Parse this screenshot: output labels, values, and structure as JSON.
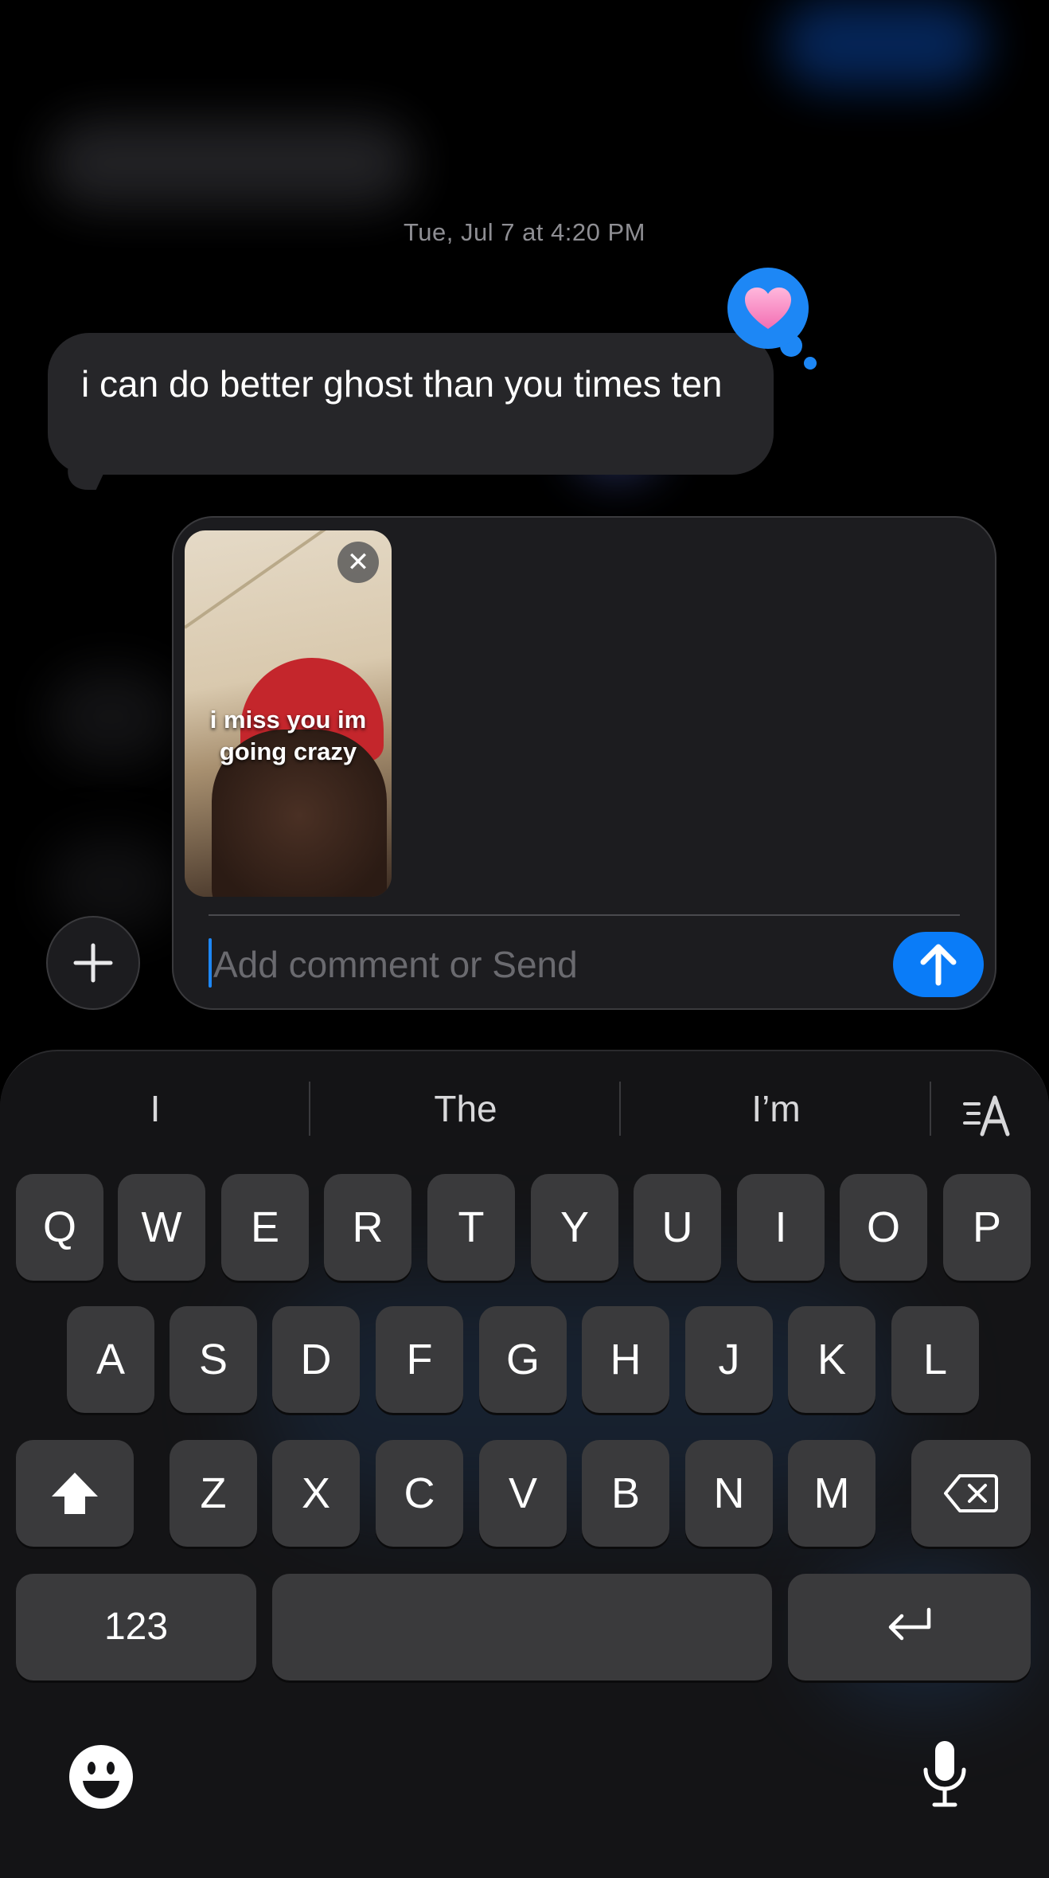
{
  "conversation": {
    "timestamp": "Tue, Jul 7 at 4:20 PM",
    "message_text": "i can do better ghost than you times ten",
    "tapback": "heart"
  },
  "compose": {
    "attachment_caption_line1": "i miss you im",
    "attachment_caption_line2": "going crazy",
    "placeholder": "Add comment or Send"
  },
  "keyboard": {
    "suggestions": [
      "I",
      "The",
      "I’m"
    ],
    "row1": [
      "Q",
      "W",
      "E",
      "R",
      "T",
      "Y",
      "U",
      "I",
      "O",
      "P"
    ],
    "row2": [
      "A",
      "S",
      "D",
      "F",
      "G",
      "H",
      "J",
      "K",
      "L"
    ],
    "row3": [
      "Z",
      "X",
      "C",
      "V",
      "B",
      "N",
      "M"
    ],
    "numbers_label": "123"
  },
  "colors": {
    "accent": "#0a7cf8",
    "bubble": "#262629",
    "key": "#3a3a3c"
  }
}
